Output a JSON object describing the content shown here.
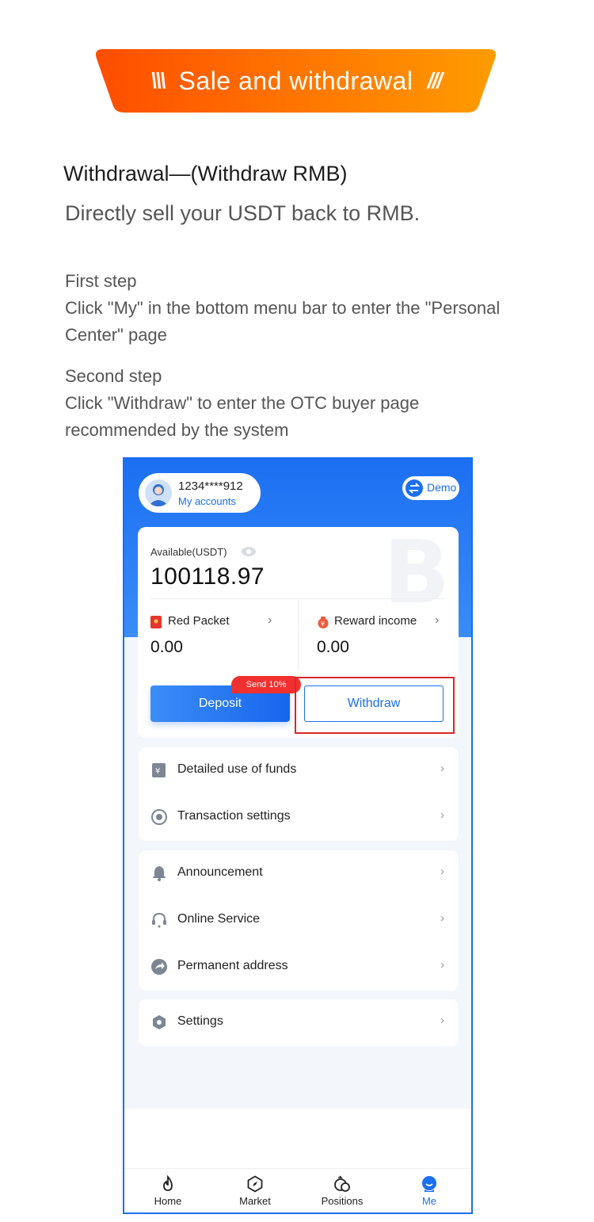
{
  "banner": {
    "title": "Sale and withdrawal",
    "colors": {
      "start": "#ff5a00",
      "end": "#ff9a00"
    }
  },
  "heading": "Withdrawal—(Withdraw RMB)",
  "subheading": "Directly sell your USDT back to RMB.",
  "steps": [
    {
      "title": "First step",
      "text": "Click \"My\" in the bottom menu bar to enter the \"Personal Center\" page"
    },
    {
      "title": "Second step",
      "text": "Click \"Withdraw\" to enter the OTC buyer page recommended by the system"
    }
  ],
  "phone": {
    "account": {
      "number": "1234****912",
      "link": "My accounts"
    },
    "demo_label": "Demo",
    "available_label": "Available(USDT)",
    "available_value": "100118.97",
    "red_packet": {
      "label": "Red Packet",
      "value": "0.00"
    },
    "reward": {
      "label": "Reward income",
      "value": "0.00"
    },
    "deposit_label": "Deposit",
    "send_badge": "Send 10%",
    "withdraw_label": "Withdraw",
    "menu_group1": [
      "Detailed use of funds",
      "Transaction settings"
    ],
    "menu_group2": [
      "Announcement",
      "Online Service",
      "Permanent address"
    ],
    "menu_group3": [
      "Settings"
    ],
    "tabs": [
      "Home",
      "Market",
      "Positions",
      "Me"
    ],
    "active_tab": "Me",
    "accent": "#1b6ff0"
  }
}
